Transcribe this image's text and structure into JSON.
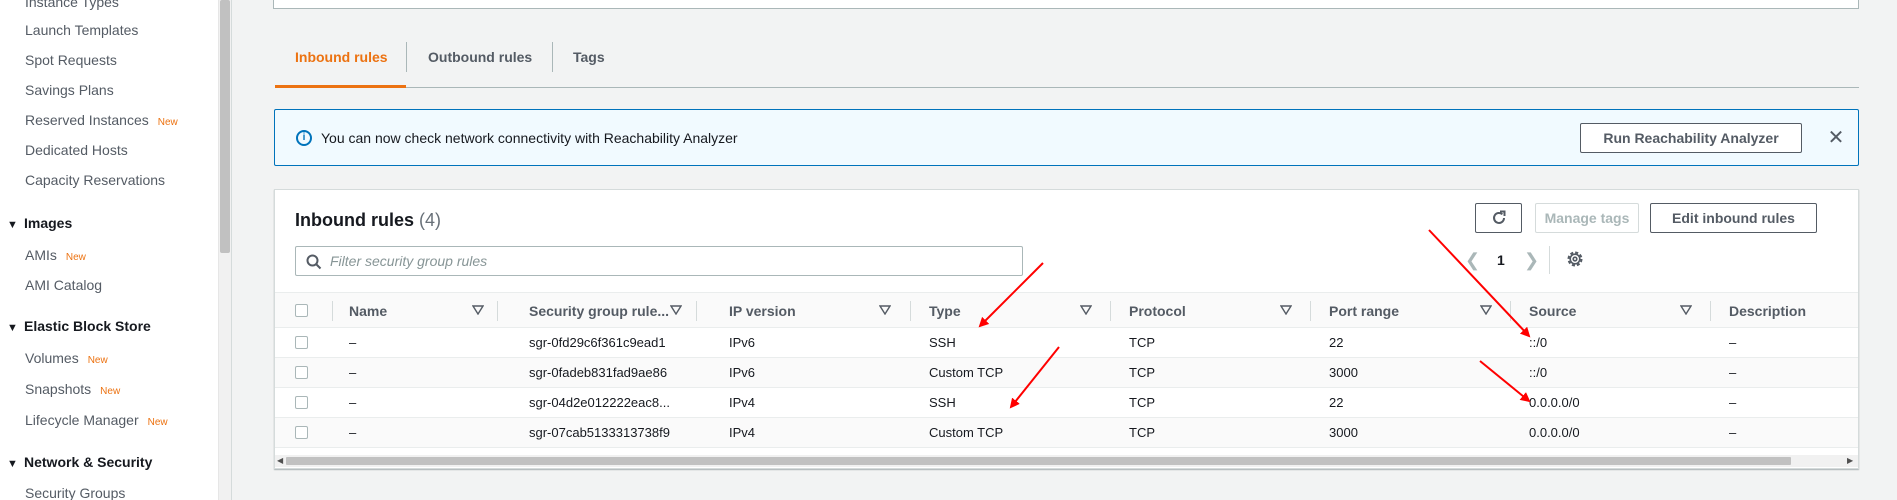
{
  "sidebar": {
    "items_top": [
      {
        "label": "Instance Types",
        "badge": ""
      },
      {
        "label": "Launch Templates",
        "badge": ""
      },
      {
        "label": "Spot Requests",
        "badge": ""
      },
      {
        "label": "Savings Plans",
        "badge": ""
      },
      {
        "label": "Reserved Instances",
        "badge": "New"
      },
      {
        "label": "Dedicated Hosts",
        "badge": ""
      },
      {
        "label": "Capacity Reservations",
        "badge": ""
      }
    ],
    "images_section": "Images",
    "images_items": [
      {
        "label": "AMIs",
        "badge": "New"
      },
      {
        "label": "AMI Catalog",
        "badge": ""
      }
    ],
    "ebs_section": "Elastic Block Store",
    "ebs_items": [
      {
        "label": "Volumes",
        "badge": "New"
      },
      {
        "label": "Snapshots",
        "badge": "New"
      },
      {
        "label": "Lifecycle Manager",
        "badge": "New"
      }
    ],
    "network_section": "Network & Security",
    "network_items": [
      {
        "label": "Security Groups",
        "badge": ""
      }
    ]
  },
  "tabs": [
    {
      "label": "Inbound rules",
      "active": true
    },
    {
      "label": "Outbound rules",
      "active": false
    },
    {
      "label": "Tags",
      "active": false
    }
  ],
  "flash": {
    "icon": "info-icon",
    "message": "You can now check network connectivity with Reachability Analyzer",
    "button": "Run Reachability Analyzer",
    "close_icon": "close-icon"
  },
  "rules": {
    "title": "Inbound rules",
    "count": "(4)",
    "refresh_icon": "refresh-icon",
    "manage_tags": "Manage tags",
    "edit_button": "Edit inbound rules",
    "filter_placeholder": "Filter security group rules",
    "page": "1",
    "columns": [
      "Name",
      "Security group rule...",
      "IP version",
      "Type",
      "Protocol",
      "Port range",
      "Source",
      "Description"
    ],
    "rows": [
      {
        "name": "–",
        "rule_id": "sgr-0fd29c6f361c9ead1",
        "ip_version": "IPv6",
        "type": "SSH",
        "protocol": "TCP",
        "port_range": "22",
        "source": "::/0",
        "description": "–"
      },
      {
        "name": "–",
        "rule_id": "sgr-0fadeb831fad9ae86",
        "ip_version": "IPv6",
        "type": "Custom TCP",
        "protocol": "TCP",
        "port_range": "3000",
        "source": "::/0",
        "description": "–"
      },
      {
        "name": "–",
        "rule_id": "sgr-04d2e012222eac8...",
        "ip_version": "IPv4",
        "type": "SSH",
        "protocol": "TCP",
        "port_range": "22",
        "source": "0.0.0.0/0",
        "description": "–"
      },
      {
        "name": "–",
        "rule_id": "sgr-07cab5133313738f9",
        "ip_version": "IPv4",
        "type": "Custom TCP",
        "protocol": "TCP",
        "port_range": "3000",
        "source": "0.0.0.0/0",
        "description": "–"
      }
    ]
  },
  "colors": {
    "accent": "#ec7211",
    "info": "#0073bb",
    "annotation_arrow": "#ff0000"
  }
}
